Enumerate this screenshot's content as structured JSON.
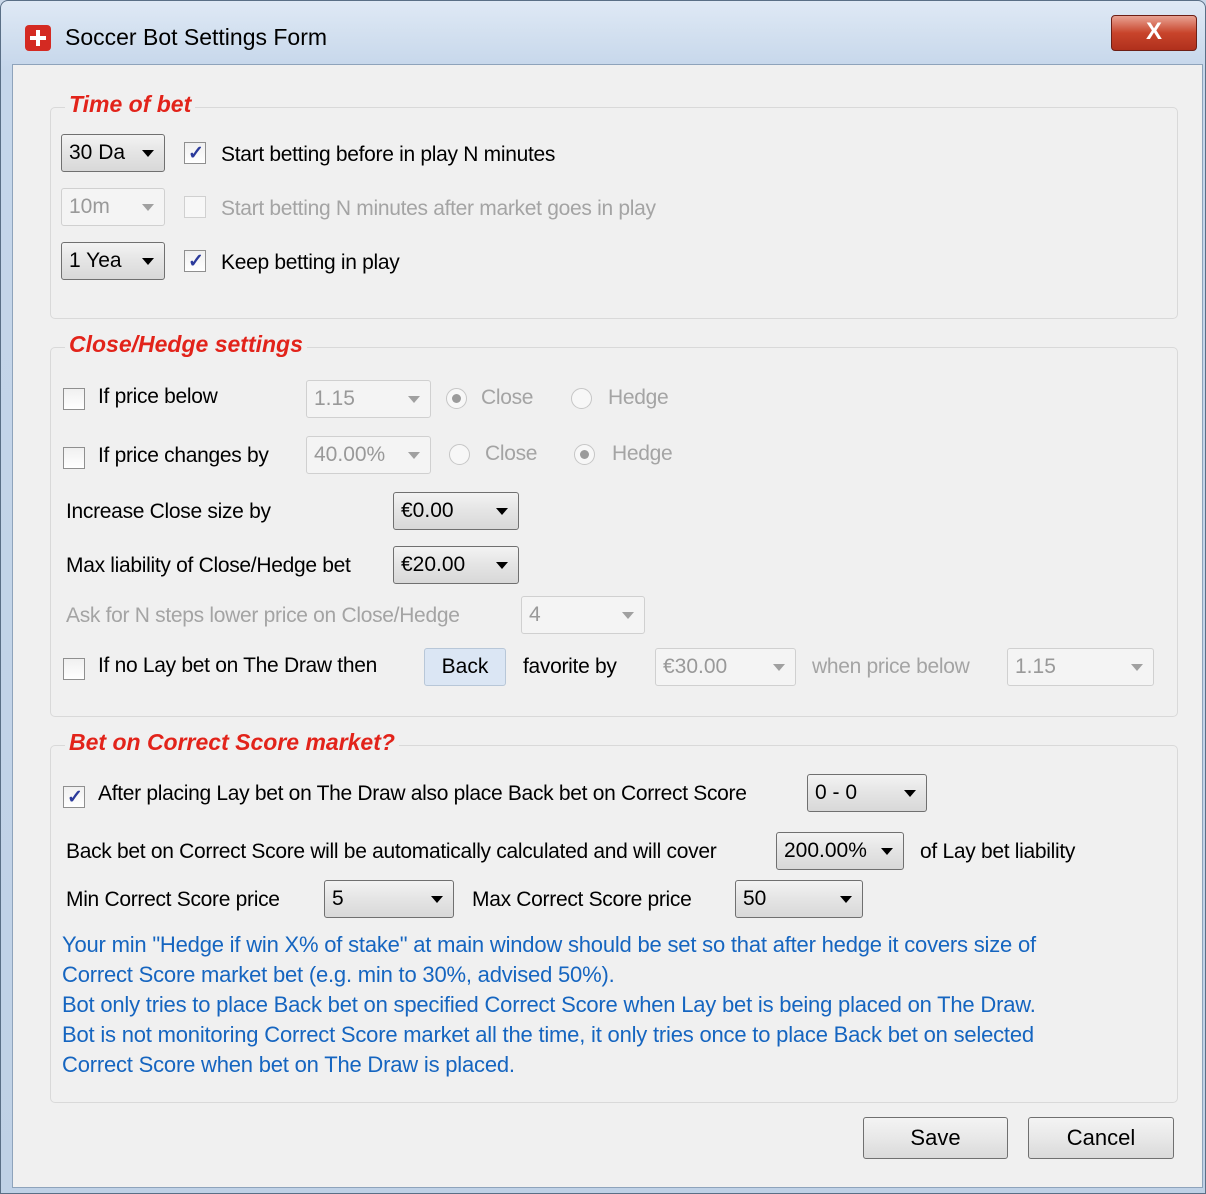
{
  "window": {
    "title": "Soccer Bot Settings Form",
    "close_glyph": "X"
  },
  "time_of_bet": {
    "title": "Time of bet",
    "rows": [
      {
        "combo": "30 Da",
        "label": "Start betting before in play N minutes",
        "checked": true,
        "enabled": true
      },
      {
        "combo": "10m",
        "label": "Start betting N minutes after market goes in play",
        "checked": false,
        "enabled": false
      },
      {
        "combo": "1 Yea",
        "label": "Keep betting in play",
        "checked": true,
        "enabled": true
      }
    ]
  },
  "close_hedge": {
    "title": "Close/Hedge settings",
    "price_below": {
      "label": "If price below",
      "value": "1.15",
      "close": "Close",
      "hedge": "Hedge",
      "selected": "Close"
    },
    "price_changes": {
      "label": "If price changes by",
      "value": "40.00%",
      "close": "Close",
      "hedge": "Hedge",
      "selected": "Hedge"
    },
    "increase_close": {
      "label": "Increase Close size by",
      "value": "€0.00"
    },
    "max_liability": {
      "label": "Max liability of Close/Hedge bet",
      "value": "€20.00"
    },
    "ask_steps": {
      "label": "Ask for N steps lower price on Close/Hedge",
      "value": "4"
    },
    "no_lay": {
      "label": "If no Lay bet on The Draw then",
      "button": "Back",
      "favorite_label": "favorite by",
      "favorite_value": "€30.00",
      "when_label": "when price below",
      "when_value": "1.15"
    }
  },
  "correct_score": {
    "title": "Bet on Correct Score market?",
    "after_placing": {
      "label": "After placing Lay bet on The Draw also place Back bet on Correct Score",
      "value": "0 - 0",
      "checked": true
    },
    "cover": {
      "label": "Back bet on Correct Score will be automatically calculated and will cover",
      "value": "200.00%",
      "suffix": "of Lay bet liability"
    },
    "min_price": {
      "label": "Min Correct Score price",
      "value": "5"
    },
    "max_price": {
      "label": "Max Correct Score price",
      "value": "50"
    },
    "info_lines": [
      "Your min \"Hedge if win X% of stake\" at main window should be set so that after hedge it covers size of",
      "Correct Score market bet (e.g. min to 30%, advised 50%).",
      "Bot only tries to place Back bet on specified Correct Score when Lay bet is being placed on The Draw.",
      "Bot is not monitoring Correct Score market all the time, it only tries once to place Back bet on selected",
      "Correct Score when bet on The Draw is placed."
    ]
  },
  "footer": {
    "save": "Save",
    "cancel": "Cancel"
  },
  "colors": {
    "group_title": "#e2231a",
    "info_text": "#1565c0",
    "close_button": "#c8442b"
  }
}
